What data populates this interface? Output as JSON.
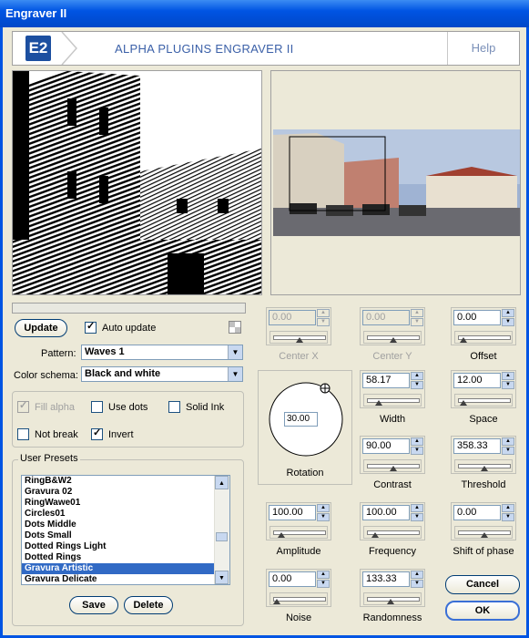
{
  "window": {
    "title": "Engraver II"
  },
  "header": {
    "logo": "E2",
    "title": "ALPHA PLUGINS ENGRAVER II",
    "help": "Help"
  },
  "update_button": "Update",
  "auto_update": {
    "label": "Auto update",
    "checked": true
  },
  "pattern": {
    "label": "Pattern:",
    "value": "Waves 1"
  },
  "color_schema": {
    "label": "Color schema:",
    "value": "Black and white"
  },
  "options": {
    "fill_alpha": "Fill alpha",
    "use_dots": "Use dots",
    "solid_ink": "Solid Ink",
    "not_break": "Not break",
    "invert": "Invert"
  },
  "presets": {
    "title": "User Presets",
    "items": [
      "RingB&W2",
      "Gravura 02",
      "RingWawe01",
      "Circles01",
      "Dots Middle",
      "Dots Small",
      "Dotted Rings Light",
      "Dotted Rings",
      "Gravura Artistic",
      "Gravura Delicate"
    ],
    "selected": "Gravura Artistic",
    "save": "Save",
    "delete": "Delete"
  },
  "controls": {
    "center_x": {
      "label": "Center X",
      "value": "0.00"
    },
    "center_y": {
      "label": "Center Y",
      "value": "0.00"
    },
    "offset": {
      "label": "Offset",
      "value": "0.00"
    },
    "width": {
      "label": "Width",
      "value": "58.17"
    },
    "space": {
      "label": "Space",
      "value": "12.00"
    },
    "contrast": {
      "label": "Contrast",
      "value": "90.00"
    },
    "threshold": {
      "label": "Threshold",
      "value": "358.33"
    },
    "amplitude": {
      "label": "Amplitude",
      "value": "100.00"
    },
    "frequency": {
      "label": "Frequency",
      "value": "100.00"
    },
    "shift": {
      "label": "Shift of phase",
      "value": "0.00"
    },
    "noise": {
      "label": "Noise",
      "value": "0.00"
    },
    "randomness": {
      "label": "Randomness",
      "value": "133.33"
    },
    "rotation": {
      "label": "Rotation",
      "value": "30.00"
    }
  },
  "buttons": {
    "cancel": "Cancel",
    "ok": "OK"
  }
}
